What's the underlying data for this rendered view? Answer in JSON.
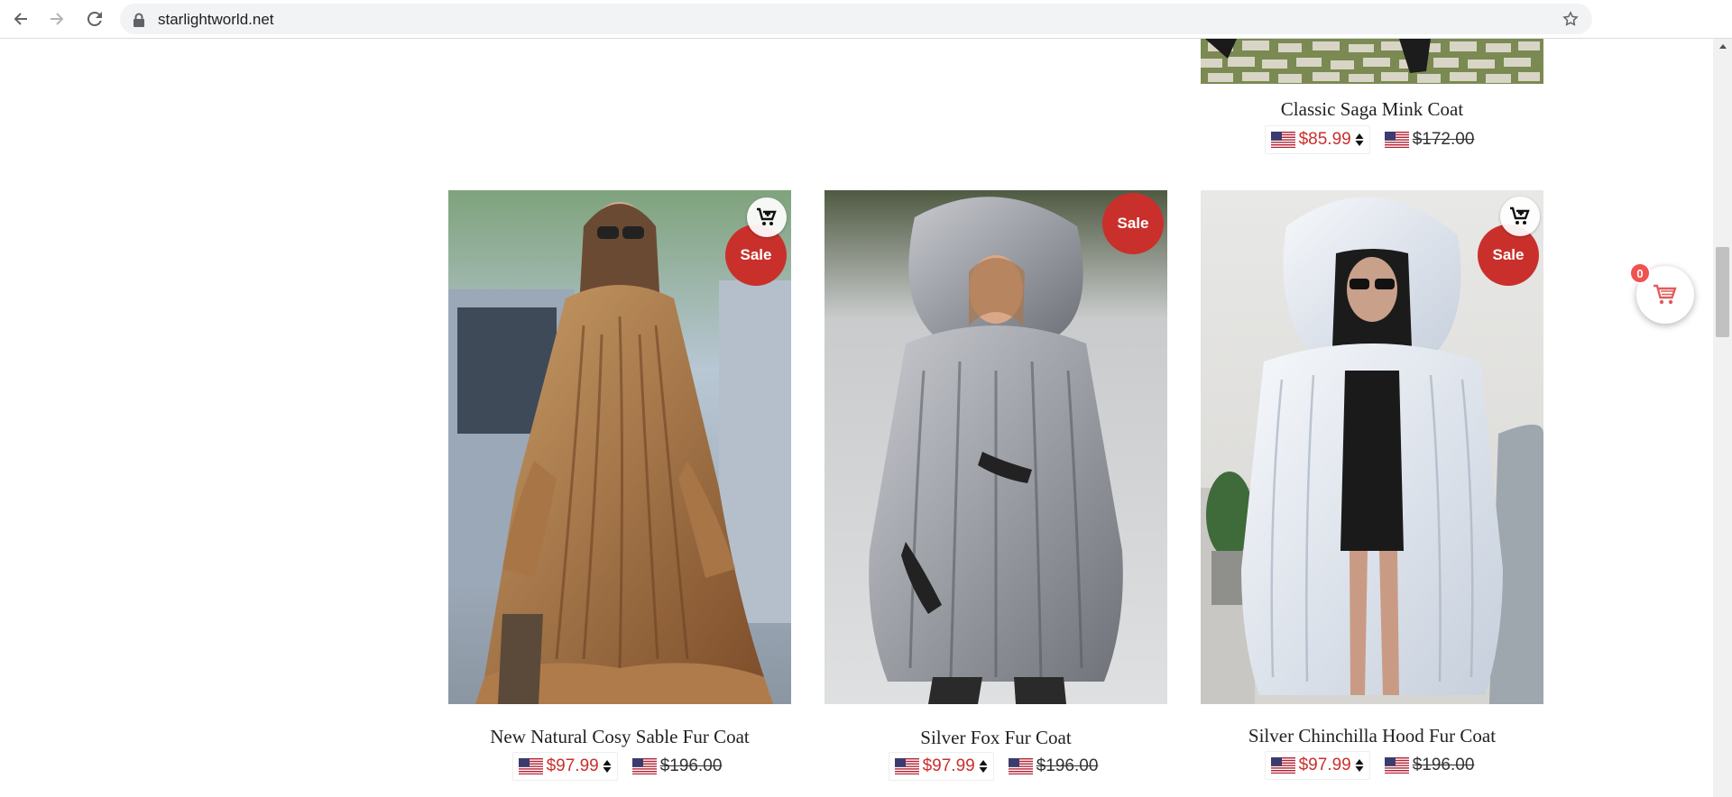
{
  "browser": {
    "url": "starlightworld.net"
  },
  "top_product": {
    "title": "Classic Saga Mink Coat",
    "sale_price": "$85.99",
    "regular_price": "$172.00"
  },
  "products": [
    {
      "title": "New Natural Cosy Sable Fur Coat",
      "badge": "Sale",
      "sale_price": "$97.99",
      "regular_price": "$196.00",
      "image_colors": [
        "#b98a5a",
        "#8a5a33"
      ]
    },
    {
      "title": "Silver Fox Fur Coat",
      "badge": "Sale",
      "sale_price": "$97.99",
      "regular_price": "$196.00",
      "image_colors": [
        "#a7a9b0",
        "#6d7076"
      ]
    },
    {
      "title": "Silver Chinchilla Hood Fur Coat",
      "badge": "Sale",
      "sale_price": "$97.99",
      "regular_price": "$196.00",
      "image_colors": [
        "#e9edf3",
        "#c3cbd6"
      ]
    }
  ],
  "floating_cart": {
    "count": "0"
  },
  "colors": {
    "sale_red": "#c9302c",
    "badge_red": "#ef5350"
  },
  "icons": {
    "back": "arrow-left-icon",
    "forward": "arrow-right-icon",
    "reload": "reload-icon",
    "lock": "lock-icon",
    "bookmark": "star-icon",
    "add_to_cart": "cart-plus-icon",
    "cart": "shopping-cart-icon"
  }
}
